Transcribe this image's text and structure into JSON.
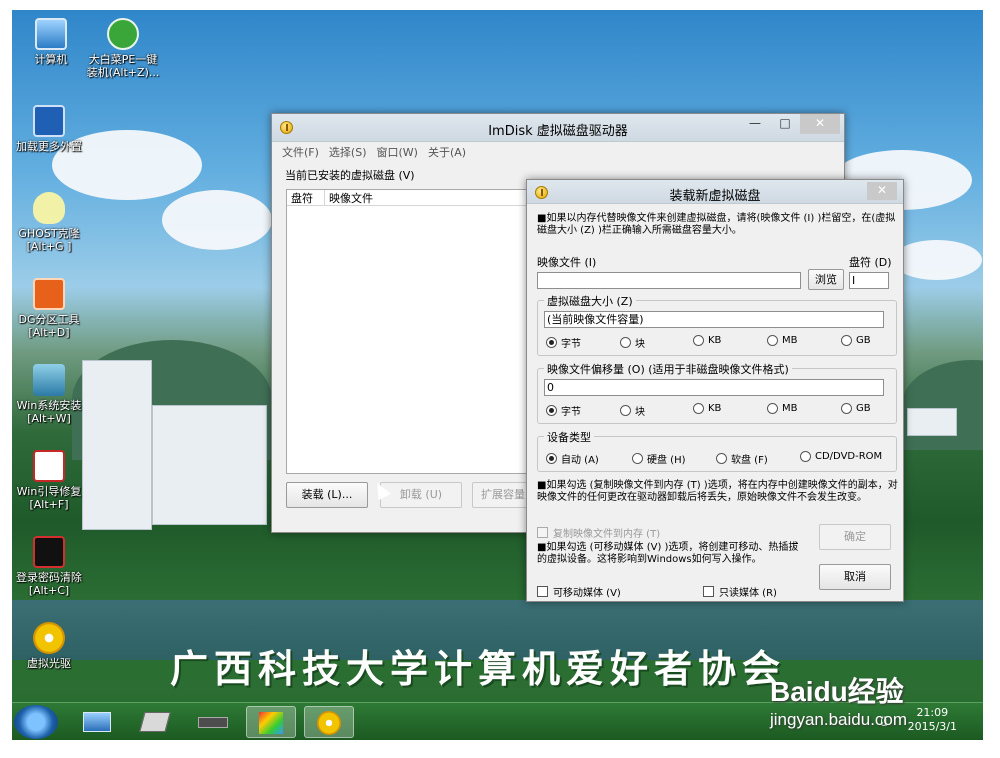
{
  "desktop": {
    "icons": [
      {
        "l1": "计算机",
        "l2": ""
      },
      {
        "l1": "大白菜PE一键",
        "l2": "装机(Alt+Z)..."
      },
      {
        "l1": "加载更多外置",
        "l2": ""
      },
      {
        "l1": "GHOST克隆",
        "l2": "[Alt+G ]"
      },
      {
        "l1": "DG分区工具",
        "l2": "[Alt+D]"
      },
      {
        "l1": "Win系统安装",
        "l2": "[Alt+W]"
      },
      {
        "l1": "Win引导修复",
        "l2": "[Alt+F]"
      },
      {
        "l1": "登录密码清除",
        "l2": "[Alt+C]"
      },
      {
        "l1": "虚拟光驱",
        "l2": ""
      }
    ],
    "banner": "广西科技大学计算机爱好者协会"
  },
  "imdisk": {
    "title": "ImDisk 虚拟磁盘驱动器",
    "minimize": "—",
    "maximize": "□",
    "close": "✕",
    "menu": [
      "文件(F)",
      "选择(S)",
      "窗口(W)",
      "关于(A)"
    ],
    "list_label": "当前已安装的虚拟磁盘 (V)",
    "columns": [
      "盘符",
      "映像文件"
    ],
    "buttons": {
      "mount": "装载 (L)...",
      "unmount": "卸载 (U)",
      "extend": "扩展容量 (E)"
    }
  },
  "mount_dialog": {
    "title": "装载新虚拟磁盘",
    "close": "✕",
    "intro": "■如果以内存代替映像文件来创建虚拟磁盘，请将(映像文件 (I) )栏留空，在(虚拟磁盘大小 (Z) )栏正确输入所需磁盘容量大小。",
    "image_file_label": "映像文件 (I)",
    "drive_letter_label": "盘符 (D)",
    "browse": "浏览",
    "drive_letter_value": "I",
    "size_group": "虚拟磁盘大小 (Z)",
    "size_value": "(当前映像文件容量)",
    "offset_group": "映像文件偏移量 (O) (适用于非磁盘映像文件格式)",
    "offset_value": "0",
    "units": [
      "字节",
      "块",
      "KB",
      "MB",
      "GB"
    ],
    "size_unit_selected": "字节",
    "offset_unit_selected": "字节",
    "device_group": "设备类型",
    "device_types": [
      "自动 (A)",
      "硬盘 (H)",
      "软盘 (F)",
      "CD/DVD-ROM"
    ],
    "device_selected": "自动 (A)",
    "note_copy": "■如果勾选 (复制映像文件到内存 (T) )选项，将在内存中创建映像文件的副本，对映像文件的任何更改在驱动器卸载后将丢失，原始映像文件不会发生改变。",
    "copy_to_mem": "复制映像文件到内存 (T)",
    "note_removable": "■如果勾选 (可移动媒体 (V) )选项，将创建可移动、热插拔的虚拟设备。这将影响到Windows如何写入操作。",
    "removable": "可移动媒体 (V)",
    "readonly": "只读媒体 (R)",
    "ok": "确定",
    "cancel": "取消"
  },
  "taskbar": {
    "time": "21:09",
    "date": "2015/3/1",
    "tray_label": "ü"
  },
  "watermark": {
    "logo": "Baidu经验",
    "url": "jingyan.baidu.com"
  }
}
